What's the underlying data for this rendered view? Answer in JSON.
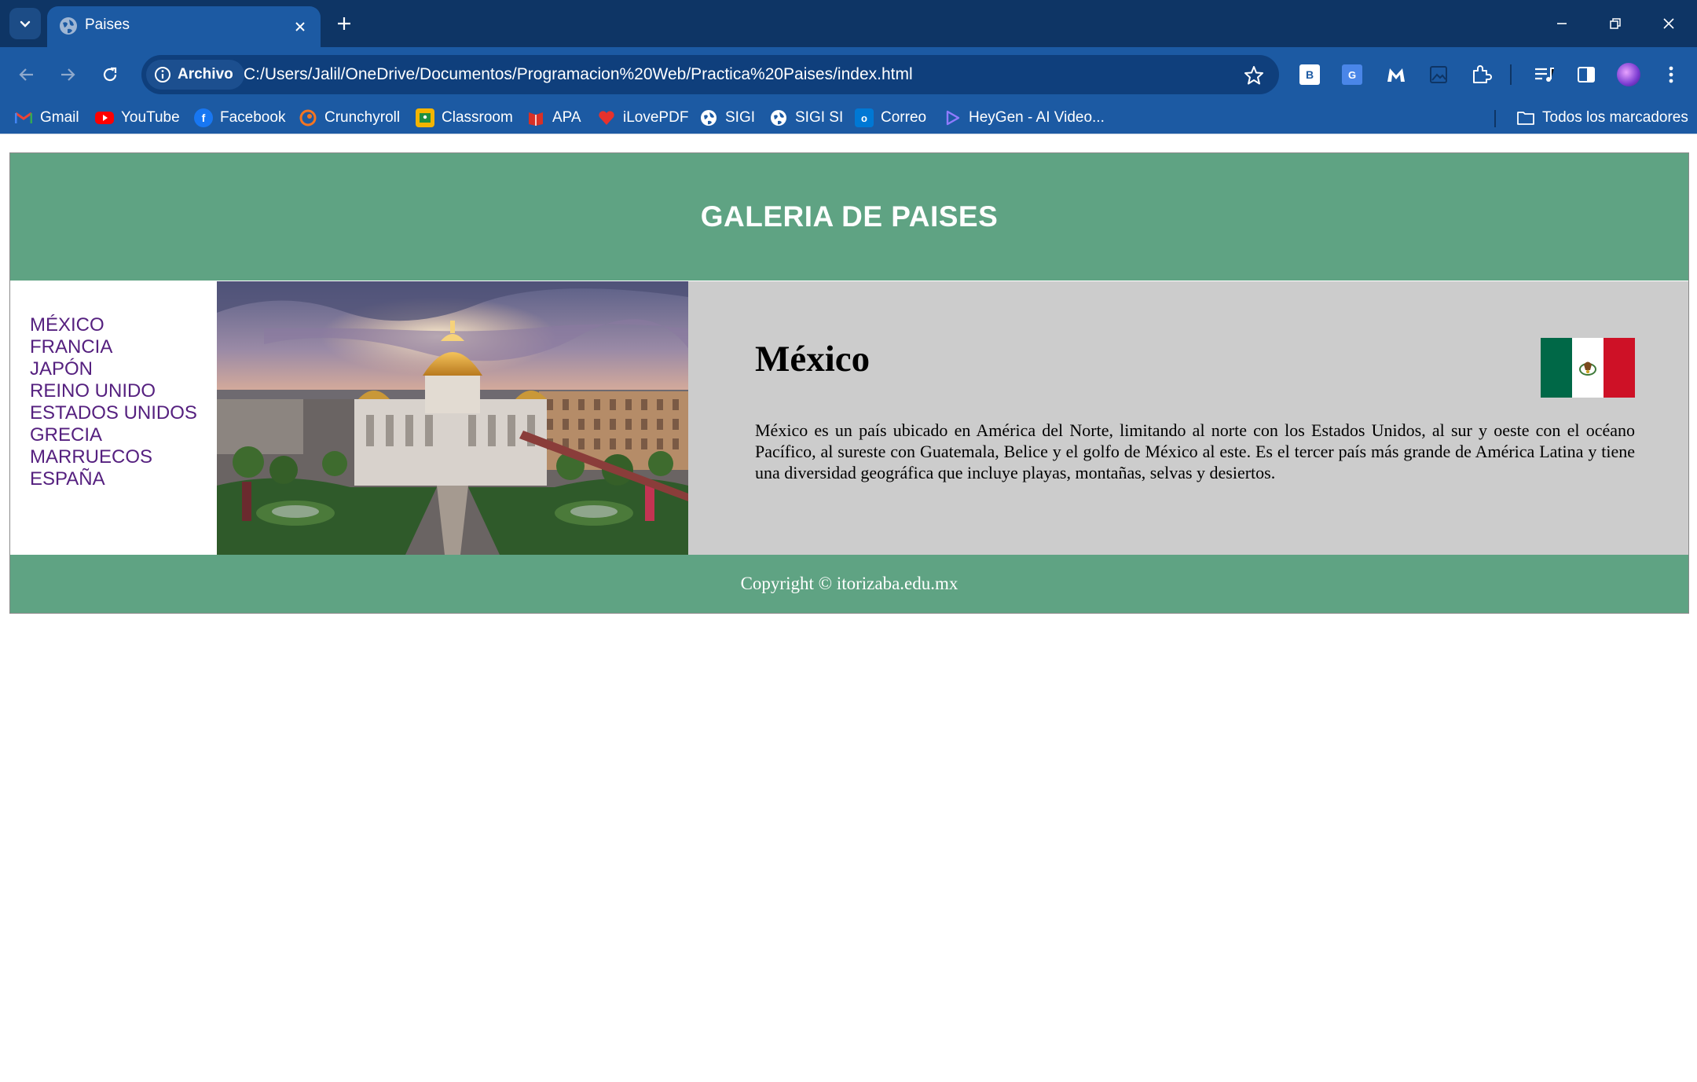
{
  "browser": {
    "tab_title": "Paises",
    "security_chip": "Archivo",
    "url": "C:/Users/Jalil/OneDrive/Documentos/Programacion%20Web/Practica%20Paises/index.html",
    "bookmarks": [
      {
        "label": "Gmail",
        "icon": "gmail-icon",
        "color": "#ea4335"
      },
      {
        "label": "YouTube",
        "icon": "youtube-icon",
        "color": "#ff0000"
      },
      {
        "label": "Facebook",
        "icon": "facebook-icon",
        "color": "#1877f2"
      },
      {
        "label": "Crunchyroll",
        "icon": "crunchyroll-icon",
        "color": "#f47521"
      },
      {
        "label": "Classroom",
        "icon": "classroom-icon",
        "color": "#f4b400"
      },
      {
        "label": "APA",
        "icon": "apa-icon",
        "color": "#d93025"
      },
      {
        "label": "iLovePDF",
        "icon": "ilovepdf-icon",
        "color": "#e5322d"
      },
      {
        "label": "SIGI",
        "icon": "globe-icon",
        "color": "#ffffff"
      },
      {
        "label": "SIGI SI",
        "icon": "globe-icon",
        "color": "#ffffff"
      },
      {
        "label": "Correo",
        "icon": "outlook-icon",
        "color": "#0078d4"
      },
      {
        "label": "HeyGen - AI Video...",
        "icon": "heygen-icon",
        "color": "#7b61ff"
      }
    ],
    "all_bookmarks": "Todos los marcadores"
  },
  "page": {
    "header_title": "GALERIA DE PAISES",
    "menu": [
      "MÉXICO",
      "FRANCIA",
      "JAPÓN",
      "REINO UNIDO",
      "ESTADOS UNIDOS",
      "GRECIA",
      "MARRUECOS",
      "ESPAÑA"
    ],
    "country_title": "México",
    "description": "México es un país ubicado en América del Norte, limitando al norte con los Estados Unidos, al sur y oeste con el océano Pacífico, al sureste con Guatemala, Belice y el golfo de México al este. Es el tercer país más grande de América Latina y tiene una diversidad geográfica que incluye playas, montañas, selvas y desiertos.",
    "footer": "Copyright © itorizaba.edu.mx"
  },
  "colors": {
    "header_bg": "#5fa383",
    "info_bg": "#cccccc",
    "menu_link": "#55207f",
    "chrome_dark": "#0e3565",
    "chrome_light": "#1c5aa3",
    "flag": [
      "#006847",
      "#ffffff",
      "#ce1126"
    ]
  }
}
